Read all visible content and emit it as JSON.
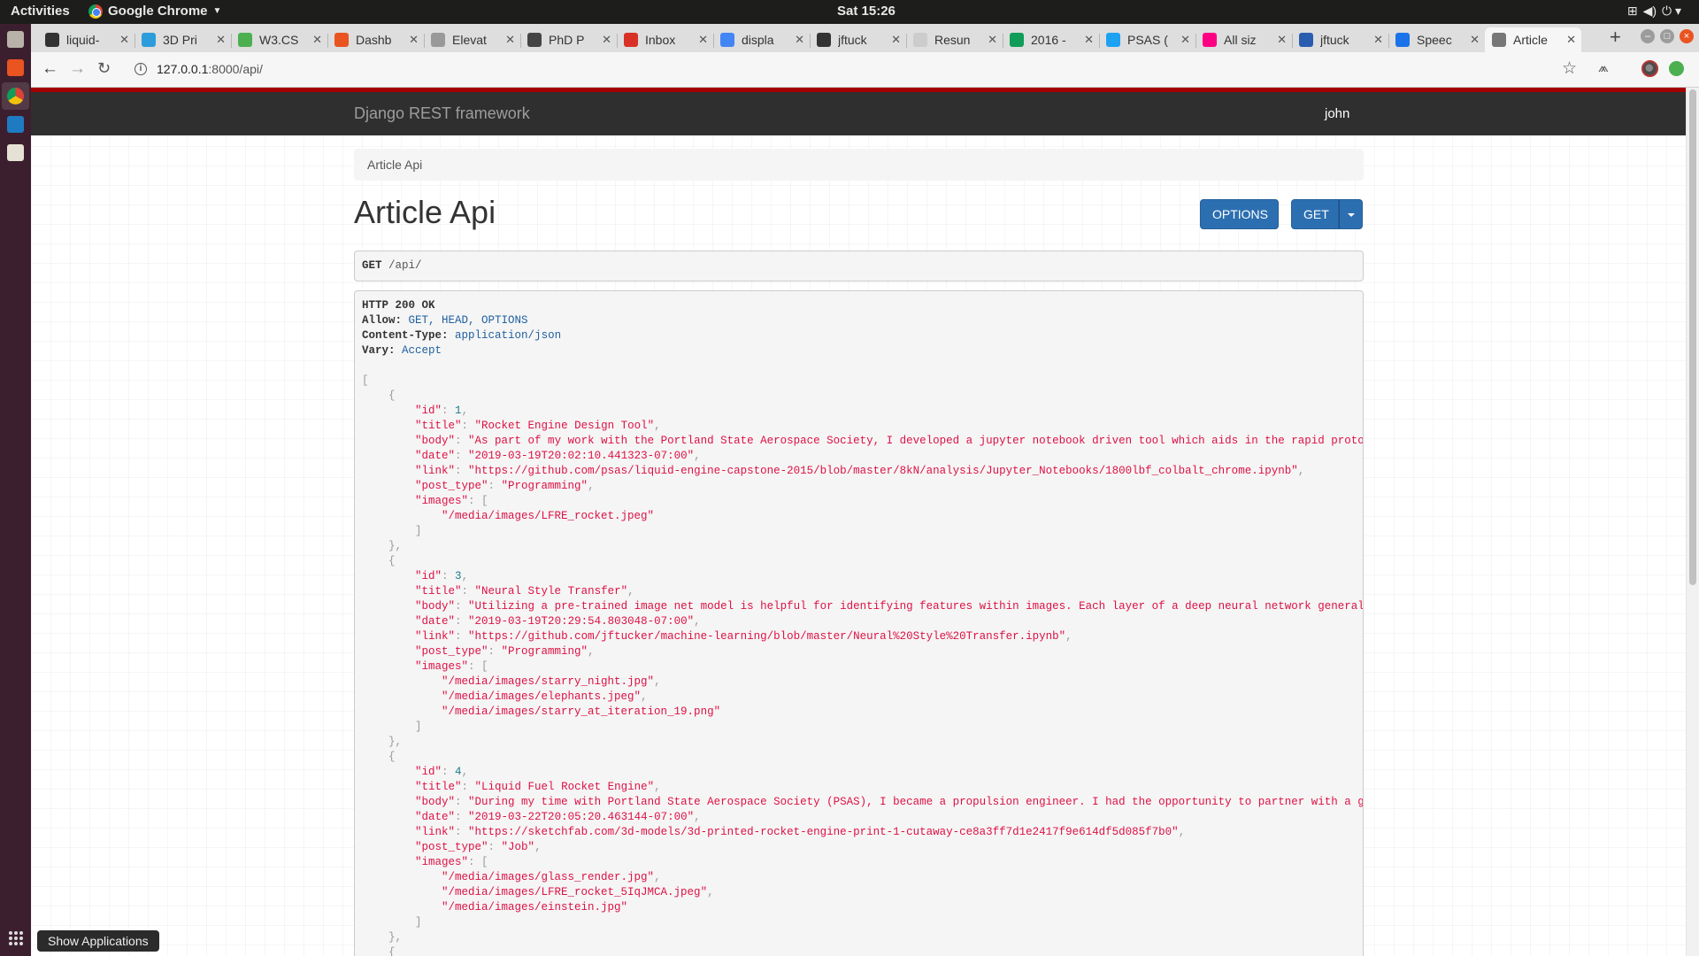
{
  "topbar": {
    "activities": "Activities",
    "app_name": "Google Chrome",
    "clock": "Sat 15:26"
  },
  "dock": {
    "tooltip": "Show Applications"
  },
  "tabs": [
    {
      "label": "liquid-",
      "favicon_color": "#333333"
    },
    {
      "label": "3D Pri",
      "favicon_color": "#2d9cdb"
    },
    {
      "label": "W3.CS",
      "favicon_color": "#4caf50"
    },
    {
      "label": "Dashb",
      "favicon_color": "#e95420"
    },
    {
      "label": "Elevat",
      "favicon_color": "#999999"
    },
    {
      "label": "PhD P",
      "favicon_color": "#444444"
    },
    {
      "label": "Inbox",
      "favicon_color": "#d93025"
    },
    {
      "label": "displa",
      "favicon_color": "#4285f4"
    },
    {
      "label": "jftuck",
      "favicon_color": "#333333"
    },
    {
      "label": "Resun",
      "favicon_color": "#cccccc"
    },
    {
      "label": "2016 -",
      "favicon_color": "#0f9d58"
    },
    {
      "label": "PSAS (",
      "favicon_color": "#1da1f2"
    },
    {
      "label": "All siz",
      "favicon_color": "#ff0084"
    },
    {
      "label": "jftuck",
      "favicon_color": "#2a5db0"
    },
    {
      "label": "Speec",
      "favicon_color": "#1a73e8"
    },
    {
      "label": "Article",
      "favicon_color": "#777777",
      "active": true
    }
  ],
  "address": {
    "host": "127.0.0.1",
    "path": ":8000/api/"
  },
  "navbar": {
    "brand": "Django REST framework",
    "user": "john"
  },
  "breadcrumb": "Article Api",
  "page_title": "Article Api",
  "buttons": {
    "options": "OPTIONS",
    "get": "GET"
  },
  "request": {
    "method": "GET",
    "url": "/api/"
  },
  "response": {
    "status": "HTTP 200 OK",
    "headers": [
      {
        "name": "Allow:",
        "value": "GET, HEAD, OPTIONS"
      },
      {
        "name": "Content-Type:",
        "value": "application/json"
      },
      {
        "name": "Vary:",
        "value": "Accept"
      }
    ],
    "articles": [
      {
        "id": "1",
        "title": "\"Rocket Engine Design Tool\"",
        "body": "\"As part of my work with the Portland State Aerospace Society, I developed a jupyter notebook driven tool which aids in the rapid prototyping",
        "date": "\"2019-03-19T20:02:10.441323-07:00\"",
        "link": "\"https://github.com/psas/liquid-engine-capstone-2015/blob/master/8kN/analysis/Jupyter_Notebooks/1800lbf_colbalt_chrome.ipynb\"",
        "post_type": "\"Programming\"",
        "images": [
          "\"/media/images/LFRE_rocket.jpeg\""
        ]
      },
      {
        "id": "3",
        "title": "\"Neural Style Transfer\"",
        "body": "\"Utilizing a pre-trained image net model is helpful for identifying features within images. Each layer of a deep neural network generally con",
        "date": "\"2019-03-19T20:29:54.803048-07:00\"",
        "link": "\"https://github.com/jftucker/machine-learning/blob/master/Neural%20Style%20Transfer.ipynb\"",
        "post_type": "\"Programming\"",
        "images": [
          "\"/media/images/starry_night.jpg\"",
          "\"/media/images/elephants.jpeg\"",
          "\"/media/images/starry_at_iteration_19.png\""
        ]
      },
      {
        "id": "4",
        "title": "\"Liquid Fuel Rocket Engine\"",
        "body": "\"During my time with Portland State Aerospace Society (PSAS), I became a propulsion engineer. I had the opportunity to partner with a group o",
        "date": "\"2019-03-22T20:05:20.463144-07:00\"",
        "link": "\"https://sketchfab.com/3d-models/3d-printed-rocket-engine-print-1-cutaway-ce8a3ff7d1e2417f9e614df5d085f7b0\"",
        "post_type": "\"Job\"",
        "images": [
          "\"/media/images/glass_render.jpg\"",
          "\"/media/images/LFRE_rocket_5IqJMCA.jpeg\"",
          "\"/media/images/einstein.jpg\""
        ]
      }
    ]
  }
}
